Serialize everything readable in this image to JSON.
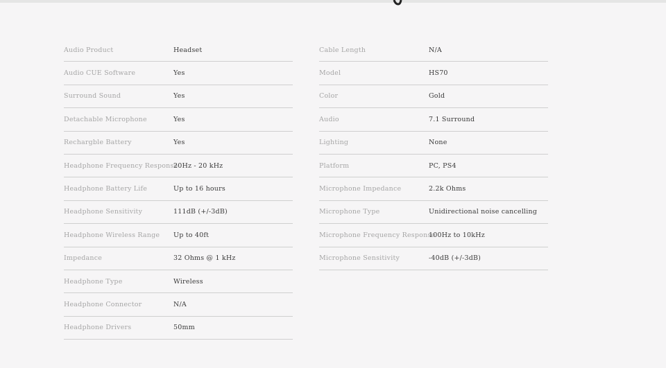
{
  "specs": {
    "left": [
      {
        "label": "Audio Product",
        "value": "Headset"
      },
      {
        "label": "Audio CUE Software",
        "value": "Yes"
      },
      {
        "label": "Surround Sound",
        "value": "Yes"
      },
      {
        "label": "Detachable Microphone",
        "value": "Yes"
      },
      {
        "label": "Rechargble Battery",
        "value": "Yes"
      },
      {
        "label": "Headphone Frequency Response",
        "value": "20Hz - 20 kHz"
      },
      {
        "label": "Headphone Battery Life",
        "value": "Up to 16 hours"
      },
      {
        "label": "Headphone Sensitivity",
        "value": "111dB (+/-3dB)"
      },
      {
        "label": "Headphone Wireless Range",
        "value": "Up to 40ft"
      },
      {
        "label": "Impedance",
        "value": "32 Ohms @ 1 kHz"
      },
      {
        "label": "Headphone Type",
        "value": "Wireless"
      },
      {
        "label": "Headphone Connector",
        "value": "N/A"
      },
      {
        "label": "Headphone Drivers",
        "value": "50mm"
      }
    ],
    "right": [
      {
        "label": "Cable Length",
        "value": "N/A"
      },
      {
        "label": "Model",
        "value": "HS70"
      },
      {
        "label": "Color",
        "value": "Gold"
      },
      {
        "label": "Audio",
        "value": "7.1 Surround"
      },
      {
        "label": "Lighting",
        "value": "None"
      },
      {
        "label": "Platform",
        "value": "PC, PS4"
      },
      {
        "label": "Microphone Impedance",
        "value": "2.2k Ohms"
      },
      {
        "label": "Microphone Type",
        "value": "Unidirectional noise cancelling"
      },
      {
        "label": "Microphone Frequency Response",
        "value": "100Hz to 10kHz"
      },
      {
        "label": "Microphone Sensitivity",
        "value": "-40dB (+/-3dB)"
      }
    ]
  }
}
